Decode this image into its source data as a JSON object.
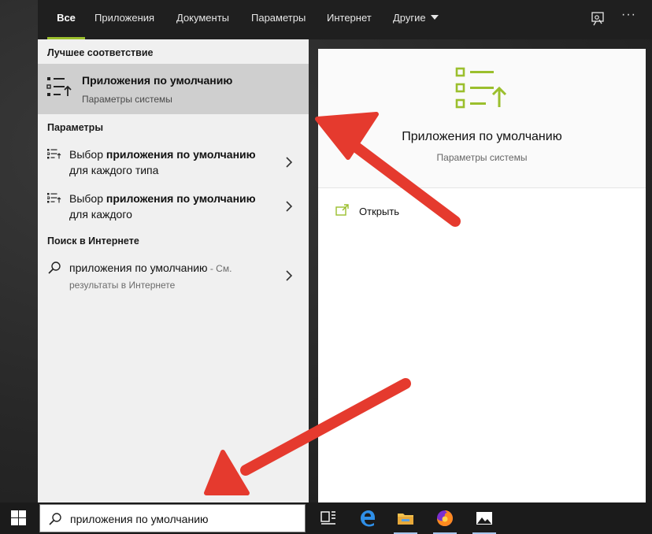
{
  "tabs": [
    {
      "label": "Все",
      "active": true
    },
    {
      "label": "Приложения"
    },
    {
      "label": "Документы"
    },
    {
      "label": "Параметры"
    },
    {
      "label": "Интернет"
    },
    {
      "label": "Другие"
    }
  ],
  "topbar": {
    "feedback_icon": "feedback-icon",
    "more_icon": "more-options-icon",
    "more_label": "···"
  },
  "left": {
    "best_match_heading": "Лучшее соответствие",
    "best_match": {
      "title": "Приложения по умолчанию",
      "subtitle": "Параметры системы"
    },
    "settings_heading": "Параметры",
    "settings_items": [
      {
        "prefix": "Выбор ",
        "bold": "приложения по умолчанию",
        "suffix": " для каждого типа"
      },
      {
        "prefix": "Выбор ",
        "bold": "приложения по умолчанию",
        "suffix": " для каждого"
      }
    ],
    "web_heading": "Поиск в Интернете",
    "web_item": {
      "query": "приложения по умолчанию",
      "hint": " - См. результаты в Интернете"
    }
  },
  "preview": {
    "title": "Приложения по умолчанию",
    "subtitle": "Параметры системы",
    "open_label": "Открыть"
  },
  "taskbar": {
    "search_value": "приложения по умолчанию",
    "apps": [
      "task-view",
      "edge",
      "file-explorer",
      "firefox",
      "photos"
    ]
  },
  "colors": {
    "accent": "#9bbf2d",
    "arrow": "#e53a2e",
    "tab_bar": "#1f1f1f",
    "left_panel": "#f0f0f0",
    "selected": "#cfcfcf",
    "taskbar": "#1b1b1b"
  }
}
